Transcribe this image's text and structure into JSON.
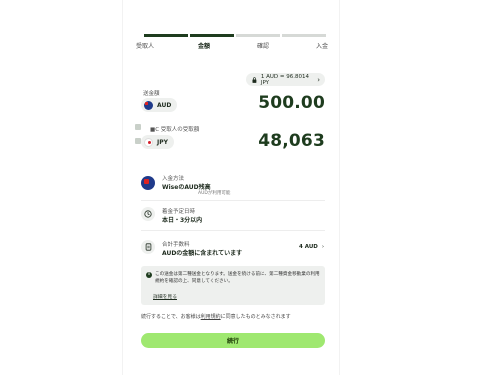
{
  "stepper": {
    "steps": [
      "受取人",
      "金額",
      "確認",
      "入金"
    ],
    "active_index": 1
  },
  "rate": {
    "text": "1 AUD = 96.8014 JPY"
  },
  "send": {
    "label": "送金額",
    "currency": "AUD",
    "amount": "500.00"
  },
  "receive": {
    "label": "受取人の受取額",
    "prefix": "■C",
    "currency": "JPY",
    "amount": "48,063"
  },
  "payment_method": {
    "title": "入金方法",
    "value": "WiseのAUD残高",
    "sub": "AUDが利用可能"
  },
  "arrival": {
    "title": "着金予定日時",
    "value": "本日・3分以内"
  },
  "fee": {
    "title": "合計手数料",
    "value": "AUDの金額に含まれています",
    "amount": "4 AUD"
  },
  "info": {
    "text": "この送金は第二種送金となります。送金を続ける前に、第二種資金移動業の利用規約を確認の上、同意してください。",
    "link": "詳細を見る"
  },
  "terms": {
    "before": "続行することで、お客様は",
    "link": "利用規約",
    "after": "に同意したものとみなされます"
  },
  "cta": {
    "label": "続行"
  },
  "colors": {
    "accent_green": "#9fe870",
    "dark_green": "#1e3c1e",
    "chip_bg": "#eef0ee"
  }
}
